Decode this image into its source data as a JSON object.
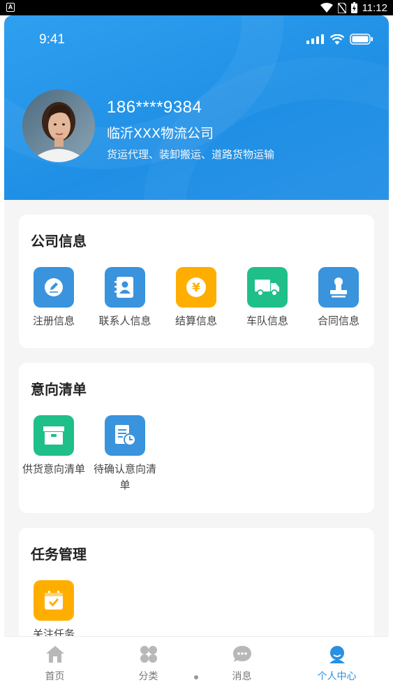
{
  "system_bar": {
    "time": "11:12"
  },
  "status_bar": {
    "time": "9:41"
  },
  "profile": {
    "phone": "186****9384",
    "company": "临沂XXX物流公司",
    "business": "货运代理、装卸搬运、道路货物运输"
  },
  "company_info": {
    "title": "公司信息",
    "items": [
      {
        "label": "注册信息",
        "icon": "edit-icon",
        "color": "#3a93dd"
      },
      {
        "label": "联系人信息",
        "icon": "contacts-icon",
        "color": "#3a93dd"
      },
      {
        "label": "结算信息",
        "icon": "yen-icon",
        "color": "#ffae00"
      },
      {
        "label": "车队信息",
        "icon": "truck-icon",
        "color": "#1fbf8a"
      },
      {
        "label": "合同信息",
        "icon": "stamp-icon",
        "color": "#3a93dd"
      }
    ]
  },
  "intent_list": {
    "title": "意向清单",
    "items": [
      {
        "label": "供货意向清单",
        "icon": "box-icon",
        "color": "#1fbf8a"
      },
      {
        "label": "待确认意向清单",
        "icon": "pending-doc-icon",
        "color": "#3a93dd"
      }
    ]
  },
  "task_management": {
    "title": "任务管理",
    "items": [
      {
        "label": "关注任务",
        "icon": "calendar-check-icon",
        "color": "#ffae00"
      }
    ]
  },
  "tabbar": {
    "items": [
      {
        "label": "首页",
        "icon": "home-icon",
        "active": false
      },
      {
        "label": "分类",
        "icon": "category-icon",
        "active": false
      },
      {
        "label": "消息",
        "icon": "message-icon",
        "active": false
      },
      {
        "label": "个人中心",
        "icon": "profile-icon",
        "active": true
      }
    ]
  },
  "colors": {
    "primary": "#2a8fe0",
    "header_bg": "#2196e8",
    "page_bg": "#f5f5f5"
  }
}
